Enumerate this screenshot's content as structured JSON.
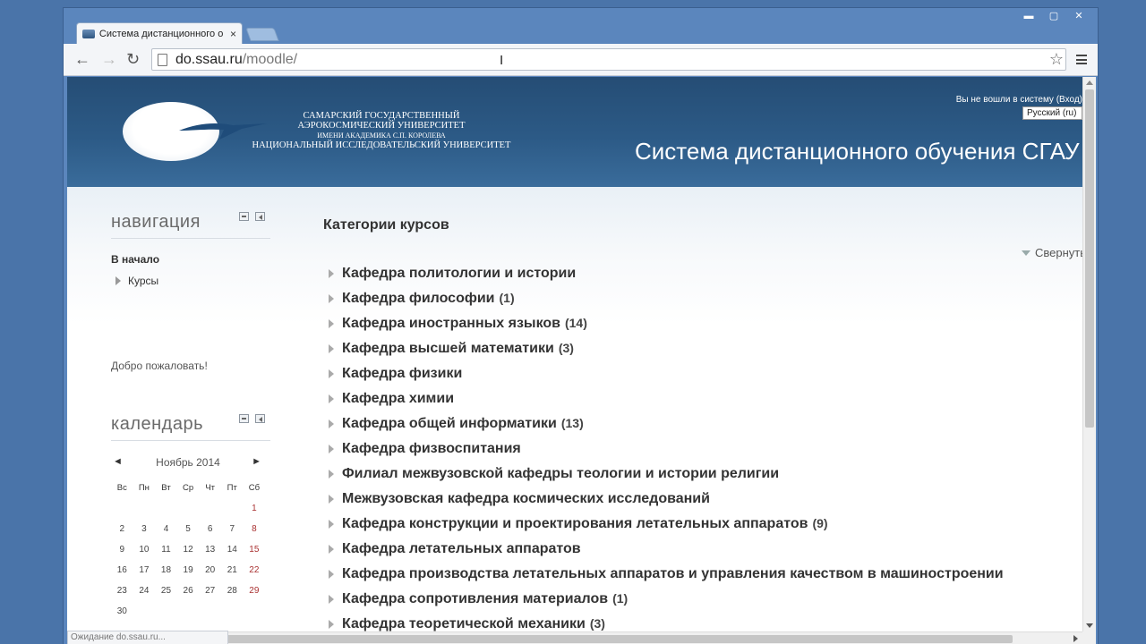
{
  "browser": {
    "tab_title": "Система дистанционного о",
    "tab_close": "×",
    "url_host": "do.ssau.ru",
    "url_path": "/moodle/",
    "back": "←",
    "forward": "→",
    "reload": "↻",
    "star": "☆",
    "cursor": "I",
    "window_controls": {
      "minimize": "▬",
      "maximize": "▢",
      "close": "✕"
    },
    "status_text": "Ожидание do.ssau.ru..."
  },
  "header": {
    "uni_line1": "САМАРСКИЙ ГОСУДАРСТВЕННЫЙ",
    "uni_line2": "АЭРОКОСМИЧЕСКИЙ УНИВЕРСИТЕТ",
    "uni_line3": "ИМЕНИ АКАДЕМИКА С.П. КОРОЛЕВА",
    "uni_line4": "НАЦИОНАЛЬНЫЙ ИССЛЕДОВАТЕЛЬСКИЙ УНИВЕРСИТЕТ",
    "login_info": "Вы не вошли в систему (Вход)",
    "language": "Русский (ru)",
    "site_title": "Система дистанционного обучения СГАУ"
  },
  "navigation": {
    "title": "навигация",
    "home": "В начало",
    "courses": "Курсы"
  },
  "welcome": "Добро пожаловать!",
  "calendar": {
    "title": "календарь",
    "prev": "◄",
    "next": "►",
    "month": "Ноябрь 2014",
    "weekdays": [
      "Вс",
      "Пн",
      "Вт",
      "Ср",
      "Чт",
      "Пт",
      "Сб"
    ],
    "weeks": [
      [
        "",
        "",
        "",
        "",
        "",
        "",
        "1"
      ],
      [
        "2",
        "3",
        "4",
        "5",
        "6",
        "7",
        "8"
      ],
      [
        "9",
        "10",
        "11",
        "12",
        "13",
        "14",
        "15"
      ],
      [
        "16",
        "17",
        "18",
        "19",
        "20",
        "21",
        "22"
      ],
      [
        "23",
        "24",
        "25",
        "26",
        "27",
        "28",
        "29"
      ],
      [
        "30",
        "",
        "",
        "",
        "",
        "",
        ""
      ]
    ]
  },
  "main": {
    "title": "Категории курсов",
    "collapse_label": "Свернуть всё",
    "categories": [
      {
        "name": "Кафедра политологии и истории",
        "count": ""
      },
      {
        "name": "Кафедра философии",
        "count": "(1)"
      },
      {
        "name": "Кафедра иностранных языков",
        "count": "(14)"
      },
      {
        "name": "Кафедра высшей математики",
        "count": "(3)"
      },
      {
        "name": "Кафедра физики",
        "count": ""
      },
      {
        "name": "Кафедра химии",
        "count": ""
      },
      {
        "name": "Кафедра общей информатики",
        "count": "(13)"
      },
      {
        "name": "Кафедра физвоспитания",
        "count": ""
      },
      {
        "name": "Филиал межвузовской кафедры теологии и истории религии",
        "count": ""
      },
      {
        "name": "Межвузовская кафедра космических исследований",
        "count": ""
      },
      {
        "name": "Кафедра конструкции и проектирования летательных аппаратов",
        "count": "(9)"
      },
      {
        "name": "Кафедра летательных аппаратов",
        "count": ""
      },
      {
        "name": "Кафедра производства летательных аппаратов и управления качеством в машиностроении",
        "count": ""
      },
      {
        "name": "Кафедра сопротивления материалов",
        "count": "(1)"
      },
      {
        "name": "Кафедра теоретической механики",
        "count": "(3)"
      }
    ]
  }
}
